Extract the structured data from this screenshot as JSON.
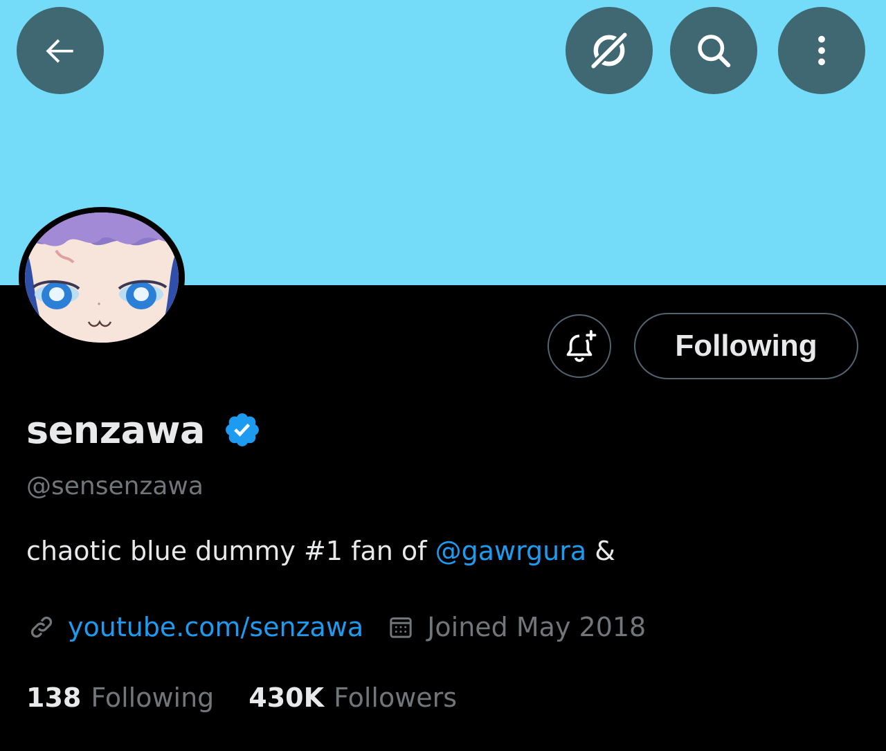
{
  "colors": {
    "banner": "#74DCF8",
    "header_button_bg": "#3F6873",
    "background": "#000000",
    "primary_text": "#E7E9EA",
    "secondary_text": "#71767B",
    "link": "#1D9BF0",
    "verified_badge": "#1D9BF0",
    "button_border": "#536471"
  },
  "header": {
    "back_icon": "arrow-left-icon",
    "actions": [
      {
        "icon": "grok-icon"
      },
      {
        "icon": "search-icon"
      },
      {
        "icon": "more-vertical-icon"
      }
    ]
  },
  "profile": {
    "avatar": "avatar-image",
    "notify_icon": "bell-plus-icon",
    "follow_button_label": "Following",
    "display_name": "senzawa",
    "verified_icon": "verified-badge-icon",
    "handle": "@sensenzawa",
    "bio_text": "chaotic blue dummy #1 fan of ",
    "bio_mention": "@gawrgura",
    "bio_suffix": " &",
    "link_icon": "link-icon",
    "website": "youtube.com/senzawa",
    "calendar_icon": "calendar-icon",
    "joined": "Joined May 2018",
    "following_count": "138",
    "following_label": "Following",
    "followers_count": "430K",
    "followers_label": "Followers"
  }
}
